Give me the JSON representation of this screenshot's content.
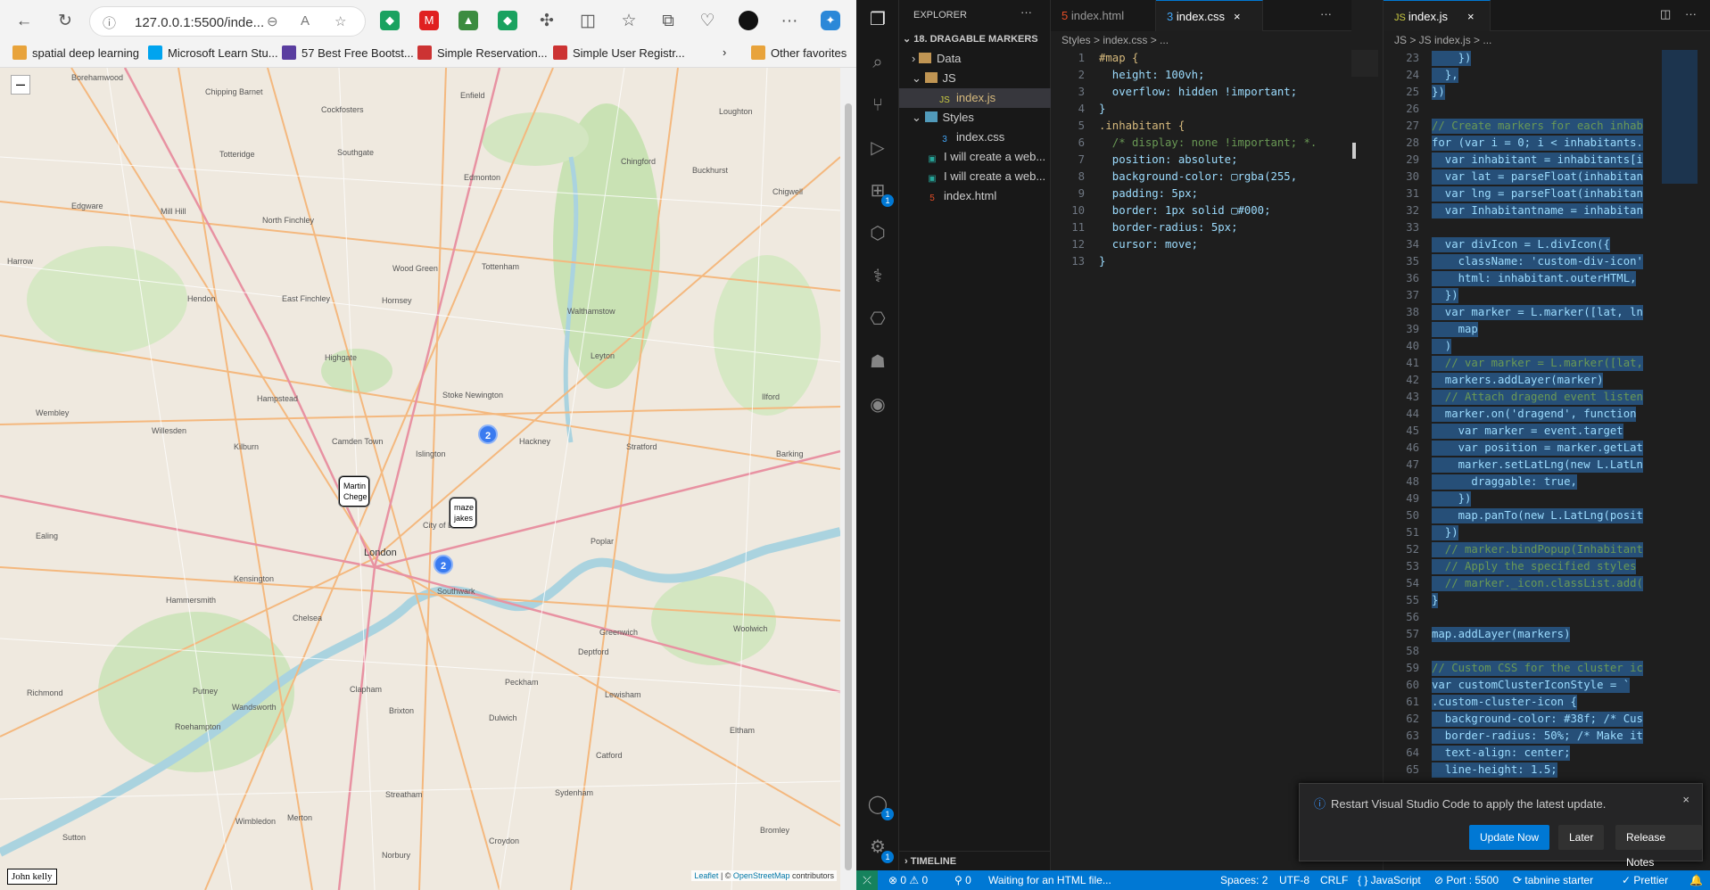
{
  "browser": {
    "url": "127.0.0.1:5500/inde...",
    "bookmarks": [
      {
        "label": "spatial deep learning",
        "color": "#e8a33b"
      },
      {
        "label": "Microsoft Learn Stu...",
        "color": "#00a4ef"
      },
      {
        "label": "57 Best Free Bootst...",
        "color": "#5a3ea0"
      },
      {
        "label": "Simple Reservation...",
        "color": "#cc3333"
      },
      {
        "label": "Simple User Registr...",
        "color": "#cc3333"
      }
    ],
    "other_favorites": "Other favorites"
  },
  "map": {
    "zoom_out": "–",
    "markers": {
      "m1": "Martin Chege",
      "m2": "maze jakes"
    },
    "clusters": {
      "c1": "2",
      "c2": "2"
    },
    "bottom_marker": "John kelly",
    "attribution_leaflet": "Leaflet",
    "attribution_sep": " | © ",
    "attribution_osm": "OpenStreetMap",
    "attribution_contrib": " contributors",
    "places": [
      "Borehamwood",
      "Chipping Barnet",
      "Enfield",
      "Loughton",
      "Totteridge",
      "Cockfosters",
      "Southgate",
      "Edmonton",
      "Chingford",
      "Buckhurst",
      "Edgware",
      "Mill Hill",
      "North Finchley",
      "Wood Green",
      "Tottenham",
      "Walthamstow",
      "Chigwell",
      "Hendon",
      "East Finchley",
      "Hornsey",
      "Leyton",
      "Harrow",
      "Hampstead",
      "Highgate",
      "Stoke Newington",
      "Ilford",
      "Wembley",
      "Willesden",
      "Kilburn",
      "Camden Town",
      "Islington",
      "Hackney",
      "Stratford",
      "Barking",
      "Ealing",
      "London",
      "City of London",
      "Poplar",
      "Greenwich",
      "Woolwich",
      "Hammersmith",
      "Chelsea",
      "Brixton",
      "Peckham",
      "Lewisham",
      "Putney",
      "Wandsworth",
      "Clapham",
      "Richmond",
      "Dulwich",
      "Catford",
      "Eltham",
      "Streatham",
      "Sutton",
      "Croydon",
      "Roehampton",
      "Wimbledon",
      "Merton",
      "Norbury",
      "Sydenham",
      "Bromley",
      "Kensington",
      "Southwark",
      "Deptford"
    ]
  },
  "editor": {
    "explorer_title": "EXPLORER",
    "folder": "18. DRAGABLE MARKERS",
    "tree": [
      "Data",
      "JS",
      "index.js",
      "Styles",
      "index.css",
      "I will create a web...",
      "I will create a web...",
      "index.html"
    ],
    "timeline": "TIMELINE",
    "tabs_left": [
      "index.html",
      "index.css"
    ],
    "tab_right": "index.js",
    "crumb_left": "Styles  >  index.css  >  ...",
    "crumb_right": "JS  >  JS  index.js  >  ...",
    "css_lines": [
      "#map {",
      "  height: 100vh;",
      "  overflow: hidden !important;",
      "}",
      ".inhabitant {",
      "  /* display: none !important; *.",
      "  position: absolute;",
      "  background-color: ▢rgba(255,",
      "  padding: 5px;",
      "  border: 1px solid ▢#000;",
      "  border-radius: 5px;",
      "  cursor: move;",
      "}"
    ],
    "js_start_line": 23,
    "js_lines": [
      "    })",
      "  },",
      "})",
      "",
      "// Create markers for each inhab",
      "for (var i = 0; i < inhabitants.",
      "  var inhabitant = inhabitants[i",
      "  var lat = parseFloat(inhabitan",
      "  var lng = parseFloat(inhabitan",
      "  var Inhabitantname = inhabitan",
      "",
      "  var divIcon = L.divIcon({",
      "    className: 'custom-div-icon'",
      "    html: inhabitant.outerHTML,",
      "  })",
      "  var marker = L.marker([lat, ln",
      "    map",
      "  )",
      "  // var marker = L.marker([lat,",
      "  markers.addLayer(marker)",
      "  // Attach dragend event listen",
      "  marker.on('dragend', function",
      "    var marker = event.target",
      "    var position = marker.getLat",
      "    marker.setLatLng(new L.LatLn",
      "      draggable: true,",
      "    })",
      "    map.panTo(new L.LatLng(posit",
      "  })",
      "  // marker.bindPopup(Inhabitant",
      "  // Apply the specified styles",
      "  // marker._icon.classList.add(",
      "}",
      "",
      "map.addLayer(markers)",
      "",
      "// Custom CSS for the cluster ic",
      "var customClusterIconStyle = `",
      ".custom-cluster-icon {",
      "  background-color: #38f; /* Cus",
      "  border-radius: 50%; /* Make it",
      "  text-align: center;",
      "  line-height: 1.5;"
    ],
    "notification": {
      "message": "Restart Visual Studio Code to apply the latest update.",
      "update": "Update Now",
      "later": "Later",
      "notes": "Release Notes"
    },
    "status": {
      "errors": "⊗ 0 ⚠ 0",
      "ports": "⚲ 0",
      "waiting": "Waiting for an HTML file...",
      "spaces": "Spaces: 2",
      "encoding": "UTF-8",
      "eol": "CRLF",
      "lang": "{ } JavaScript",
      "port": "⊘ Port : 5500",
      "tabnine": "⟳ tabnine starter",
      "prettier": "✓ Prettier",
      "bell": "🔔"
    }
  }
}
